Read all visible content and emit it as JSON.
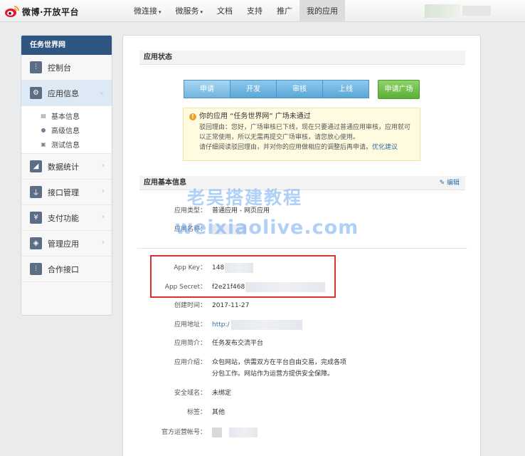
{
  "header": {
    "logo_text": "微博·开放平台",
    "nav": [
      {
        "label": "微连接",
        "caret": "▾"
      },
      {
        "label": "微服务",
        "caret": "▾"
      },
      {
        "label": "文档"
      },
      {
        "label": "支持"
      },
      {
        "label": "推广"
      },
      {
        "label": "我的应用"
      }
    ]
  },
  "sidebar": {
    "title": "任务世界网",
    "items": [
      {
        "label": "控制台",
        "icon": "sliders-icon"
      },
      {
        "label": "应用信息",
        "icon": "gear-icon"
      },
      {
        "label": "数据统计",
        "icon": "chart-icon"
      },
      {
        "label": "接口管理",
        "icon": "plug-icon"
      },
      {
        "label": "支付功能",
        "icon": "yen-icon"
      },
      {
        "label": "管理应用",
        "icon": "layers-icon"
      },
      {
        "label": "合作接口",
        "icon": "sliders-icon"
      }
    ],
    "sub_items": [
      {
        "label": "基本信息",
        "icon": "card-icon"
      },
      {
        "label": "高级信息",
        "icon": "info-icon"
      },
      {
        "label": "测试信息",
        "icon": "user-card-icon"
      }
    ]
  },
  "status": {
    "section_title": "应用状态",
    "steps": [
      "申请",
      "开发",
      "审核",
      "上线"
    ],
    "plaza_button": "申请广场",
    "notice_title": "你的应用 “任务世界网” 广场未通过",
    "notice_body": "驳回理由：您好，广场审核已下线，现在只要通过普通应用审核，应用就可以正常使用，所以无需再提交广场审核，请您放心使用。",
    "notice_tail": "请仔细阅读驳回理由，并对你的应用做相应的调整后再申请。",
    "notice_link": "优化建议"
  },
  "basic": {
    "section_title": "应用基本信息",
    "edit_label": "编辑",
    "app_type_label": "应用类型：",
    "app_type_value": "普通应用 - 网页应用",
    "app_name_label": "应用名称：",
    "app_key_label": "App Key：",
    "app_key_value": "148",
    "app_secret_label": "App Secret：",
    "app_secret_value": "f2e21f468",
    "created_label": "创建时间：",
    "created_value": "2017-11-27",
    "url_label": "应用地址：",
    "url_value": "http:/",
    "summary_label": "应用简介：",
    "summary_value": "任务发布交流平台",
    "intro_label": "应用介绍：",
    "intro_line1": "众包网站，供需双方在平台自由交易，完成各项",
    "intro_line2": "分包工作。网站作为运营方提供安全保障。",
    "domain_label": "安全域名：",
    "domain_value": "未绑定",
    "tag_label": "标签：",
    "tag_value": "其他",
    "official_label": "官方运营帐号："
  },
  "watermark": {
    "line1": "老吴搭建教程",
    "line2": "weixiaolive.com"
  }
}
